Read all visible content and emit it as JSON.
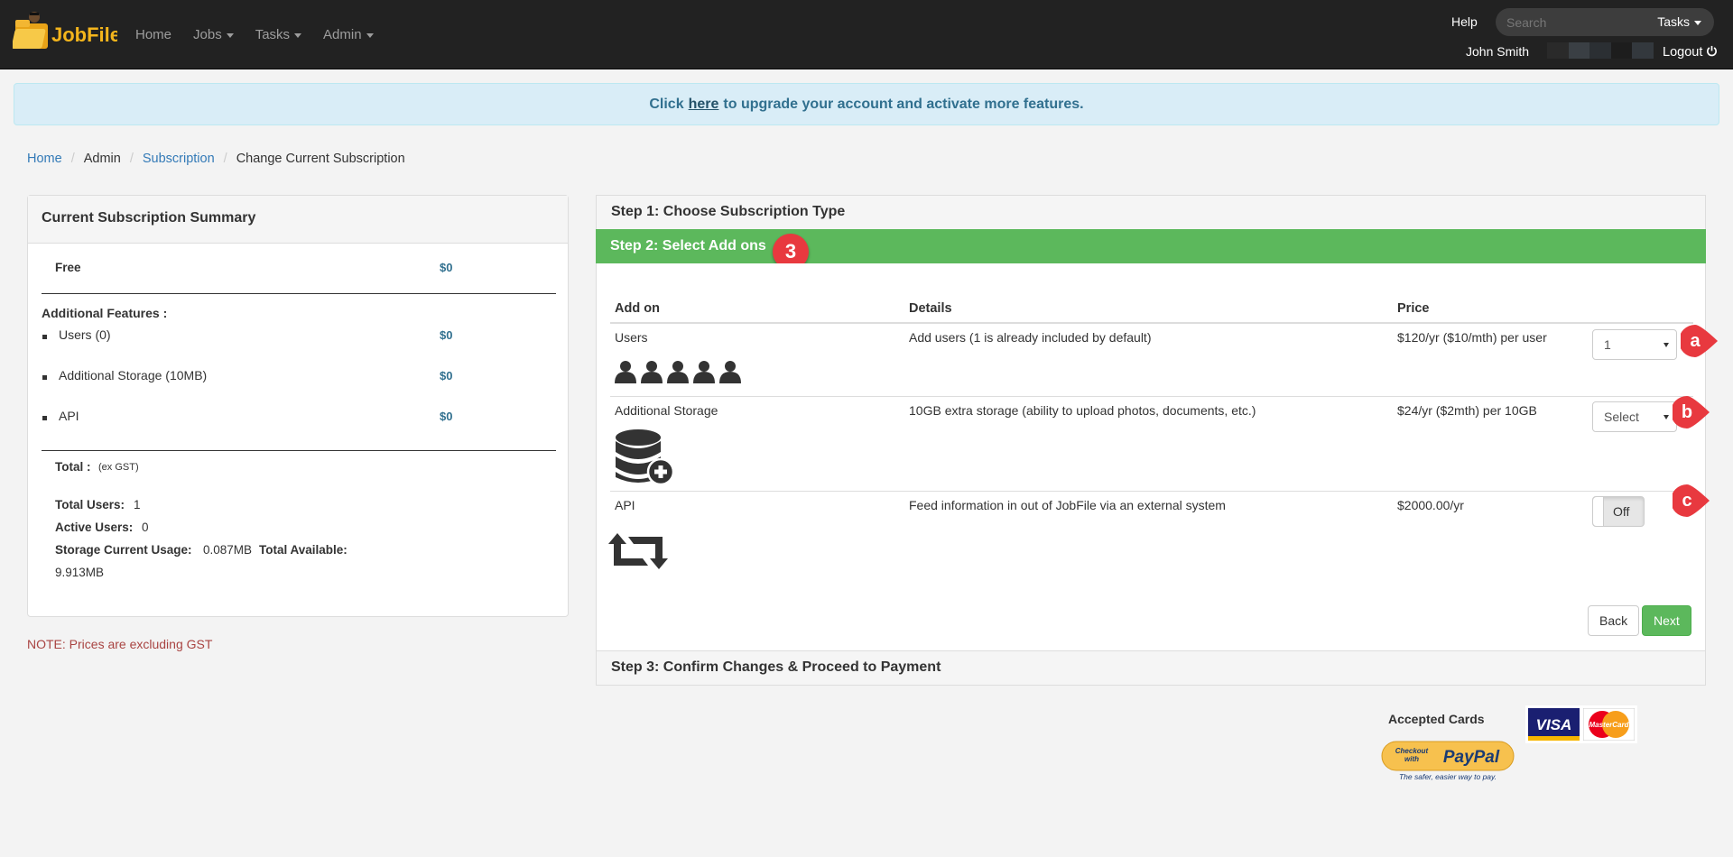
{
  "nav": {
    "brand": "JobFile",
    "items": [
      {
        "label": "Home",
        "dropdown": false
      },
      {
        "label": "Jobs",
        "dropdown": true
      },
      {
        "label": "Tasks",
        "dropdown": true
      },
      {
        "label": "Admin",
        "dropdown": true
      }
    ],
    "help": "Help",
    "search_placeholder": "Search",
    "search_scope": "Tasks",
    "user_name": "John Smith",
    "logout": "Logout"
  },
  "alert": {
    "prefix": "Click",
    "link": "here",
    "suffix": "to upgrade your account and activate more features."
  },
  "breadcrumb": {
    "home": "Home",
    "admin": "Admin",
    "subscription": "Subscription",
    "current": "Change Current Subscription"
  },
  "summary": {
    "title": "Current Subscription Summary",
    "plan_name": "Free",
    "plan_price": "$0",
    "features_label": "Additional Features :",
    "features": [
      {
        "label": "Users (0)",
        "price": "$0"
      },
      {
        "label": "Additional Storage (10MB)",
        "price": "$0"
      },
      {
        "label": "API",
        "price": "$0"
      }
    ],
    "total_label": "Total :",
    "total_note": "(ex GST)",
    "total_users_label": "Total Users:",
    "total_users": "1",
    "active_users_label": "Active Users:",
    "active_users": "0",
    "storage_label": "Storage Current Usage:",
    "storage_value": "0.087MB",
    "available_label": "Total Available:",
    "available_value": "9.913MB"
  },
  "note": "NOTE: Prices are excluding GST",
  "steps": {
    "step1": "Step 1: Choose Subscription Type",
    "step2": "Step 2: Select Add ons",
    "step3": "Step 3: Confirm Changes & Proceed to Payment"
  },
  "annotations": {
    "step_marker": "3",
    "a": "a",
    "b": "b",
    "c": "c"
  },
  "addons": {
    "headers": {
      "addon": "Add on",
      "details": "Details",
      "price": "Price"
    },
    "rows": [
      {
        "name": "Users",
        "details": "Add users (1 is already included by default)",
        "price": "$120/yr ($10/mth) per user",
        "control": "1",
        "icon": "users-icon"
      },
      {
        "name": "Additional Storage",
        "details": "10GB extra storage (ability to upload photos, documents, etc.)",
        "price": "$24/yr ($2mth) per 10GB",
        "control": "Select",
        "icon": "database-add-icon"
      },
      {
        "name": "API",
        "details": "Feed information in out of JobFile via an external system",
        "price": "$2000.00/yr",
        "control": "Off",
        "icon": "retweet-icon"
      }
    ]
  },
  "buttons": {
    "back": "Back",
    "next": "Next"
  },
  "payments": {
    "accepted": "Accepted Cards",
    "visa": "VISA",
    "mastercard": "MasterCard",
    "paypal_line1": "Checkout",
    "paypal_line2": "with",
    "paypal_brand": "PayPal",
    "paypal_tagline": "The safer, easier way to pay."
  },
  "colors": {
    "navbar": "#222222",
    "success": "#5cb85c",
    "alert_bg": "#d9edf7",
    "badge": "#e8393f"
  }
}
